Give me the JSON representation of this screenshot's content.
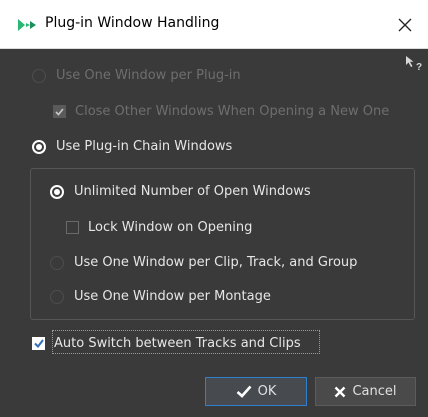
{
  "window": {
    "title": "Plug-in Window Handling",
    "icons": {
      "app": "wavelab-app-icon",
      "close": "close-icon",
      "help": "context-help-icon"
    }
  },
  "options": {
    "one_window_per_plugin": {
      "label": "Use One Window per Plug-in",
      "selected": false,
      "enabled": false
    },
    "close_other_windows": {
      "label": "Close Other Windows When Opening a New One",
      "checked": true,
      "enabled": false
    },
    "plugin_chain_windows": {
      "label": "Use Plug-in Chain Windows",
      "selected": true,
      "enabled": true
    }
  },
  "chain_group": {
    "unlimited_windows": {
      "label": "Unlimited Number of Open Windows",
      "selected": true
    },
    "lock_window": {
      "label": "Lock Window on Opening",
      "checked": false
    },
    "one_per_clip_track_group": {
      "label": "Use One Window per Clip, Track, and Group",
      "selected": false
    },
    "one_per_montage": {
      "label": "Use One Window per Montage",
      "selected": false
    }
  },
  "auto_switch": {
    "label": "Auto Switch between Tracks and Clips",
    "checked": true
  },
  "buttons": {
    "ok": {
      "label": "OK",
      "icon": "checkmark-icon"
    },
    "cancel": {
      "label": "Cancel",
      "icon": "x-icon"
    }
  },
  "colors": {
    "background": "#3a3a3a",
    "title_bar": "#ffffff",
    "accent_blue": "#2f7fcf",
    "app_icon_green": "#2bb673"
  }
}
